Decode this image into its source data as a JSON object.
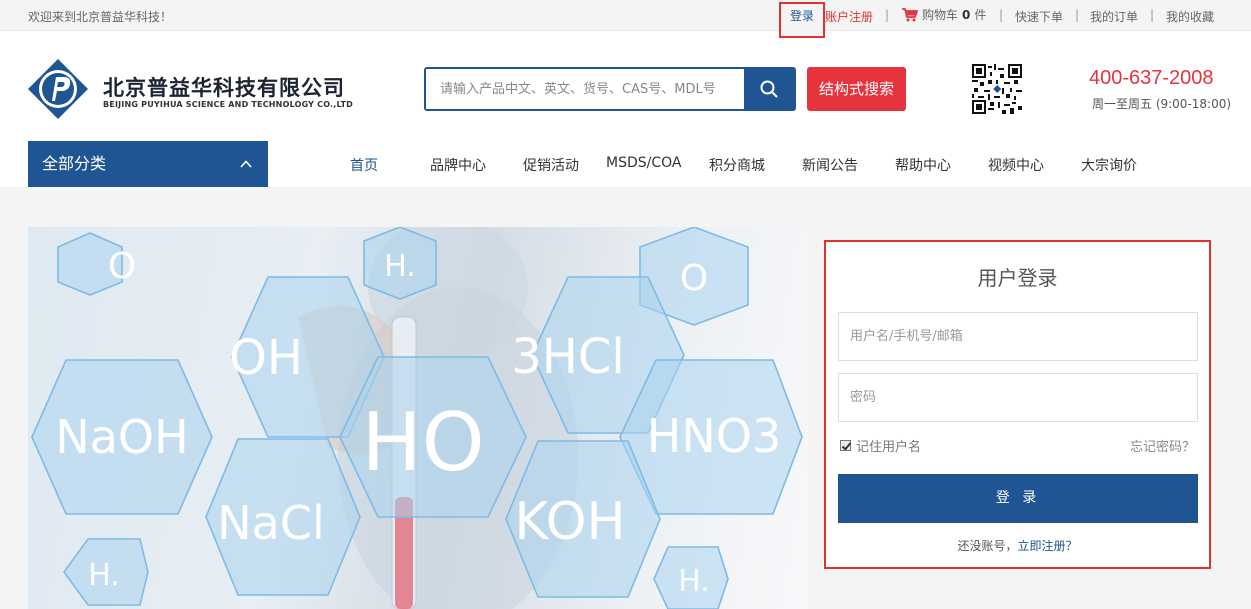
{
  "topbar": {
    "welcome": "欢迎来到北京普益华科技！",
    "login": "登录",
    "register": "账户注册",
    "cart_label": "购物车",
    "cart_count": "0",
    "cart_unit": "件",
    "quick_order": "快速下单",
    "my_orders": "我的订单",
    "my_favorites": "我的收藏",
    "separator": "|"
  },
  "header": {
    "company_cn": "北京普益华科技有限公司",
    "company_en": "BEIJING PUYIHUA SCIENCE AND TECHNOLOGY CO.,LTD",
    "search_placeholder": "请输入产品中文、英文、货号、CAS号、MDL号",
    "structure_search": "结构式搜索",
    "hotline": "400-637-2008",
    "hours": "周一至周五 (9:00-18:00)"
  },
  "nav": {
    "all_categories": "全部分类",
    "items": [
      {
        "label": "首页",
        "active": true
      },
      {
        "label": "品牌中心"
      },
      {
        "label": "促销活动"
      },
      {
        "label": "MSDS/COA"
      },
      {
        "label": "积分商城"
      },
      {
        "label": "新闻公告"
      },
      {
        "label": "帮助中心"
      },
      {
        "label": "视频中心"
      },
      {
        "label": "大宗询价"
      }
    ]
  },
  "banner": {
    "molecules": [
      "O",
      "H.",
      "O",
      "OH",
      "3HCl",
      "NaOH",
      "HO",
      "HNO3",
      "NaCl",
      "KOH",
      "H.",
      "H."
    ]
  },
  "login": {
    "title": "用户登录",
    "username_placeholder": "用户名/手机号/邮箱",
    "password_placeholder": "密码",
    "remember": "记住用户名",
    "forgot": "忘记密码？",
    "submit": "登 录",
    "no_account": "还没账号，",
    "register_now": "立即注册？"
  },
  "colors": {
    "brand_blue": "#1f5592",
    "accent_red": "#e5343d",
    "highlight_border": "#e0332f"
  }
}
